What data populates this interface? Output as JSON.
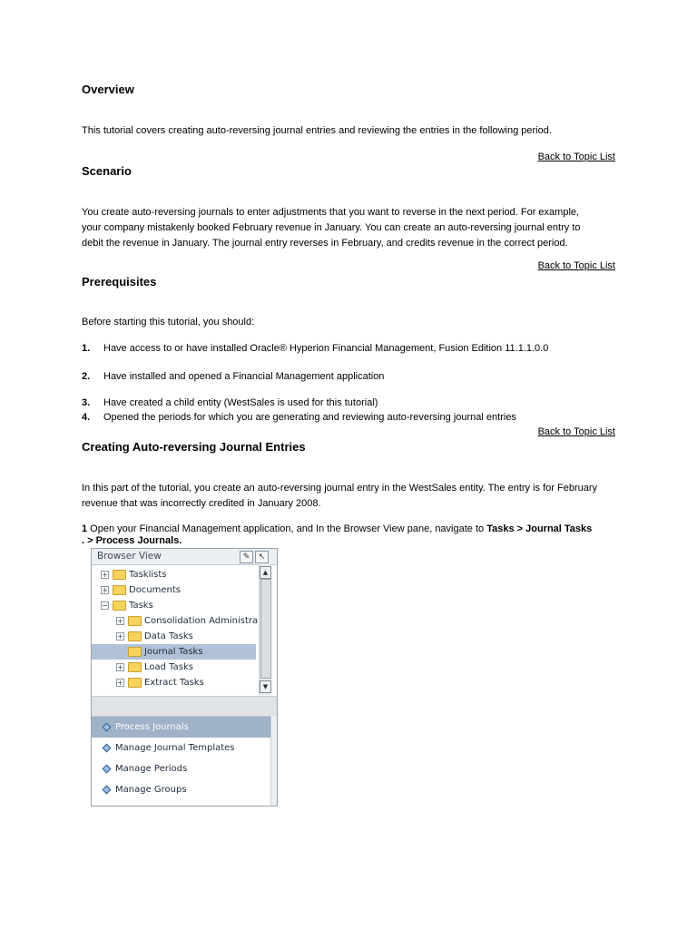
{
  "overview": {
    "heading": "Overview",
    "text": "This tutorial covers creating auto-reversing journal entries and reviewing the entries in the following period."
  },
  "back_link": "Back to Topic List",
  "scenario": {
    "heading": "Scenario",
    "lines": [
      "You create auto-reversing journals to enter adjustments that you want to reverse in the next period. For example,",
      "your company mistakenly booked February revenue in January. You can create an auto-reversing journal entry to",
      "debit the revenue in January. The journal entry reverses in February, and credits revenue in the correct period."
    ]
  },
  "prerequisites": {
    "heading": "Prerequisites",
    "intro": "Before starting this tutorial, you should:",
    "items": [
      {
        "num": "1.",
        "text": "Have access to or have installed Oracle® Hyperion Financial Management, Fusion Edition 11.1.1.0.0"
      },
      {
        "num": "2.",
        "text": "Have installed and opened a Financial Management application"
      },
      {
        "num": "3.",
        "text": "Have created a child entity (WestSales is used for this tutorial)"
      },
      {
        "num": "4.",
        "text": "Opened the periods for which you are generating and reviewing auto-reversing journal entries"
      }
    ]
  },
  "creating": {
    "heading": "Creating Auto-reversing Journal Entries",
    "lines": [
      "In this part of the tutorial, you create an auto-reversing journal entry in the WestSales entity. The entry is for February",
      "revenue that was incorrectly credited in January 2008."
    ],
    "step_num": "1",
    "step_text": " Open your Financial Management application, and In the Browser View pane, navigate to ",
    "step_bold1": "Tasks > Journal Tasks",
    "step_dot": ". > ",
    "step_bold2": "Process Journals."
  },
  "browser": {
    "title": "Browser View",
    "tree": [
      {
        "label": "Tasklists",
        "exp": "+"
      },
      {
        "label": "Documents",
        "exp": "+"
      },
      {
        "label": "Tasks",
        "exp": "−"
      },
      {
        "label": "Consolidation Administra...",
        "exp": "+"
      },
      {
        "label": "Data Tasks",
        "exp": "+"
      },
      {
        "label": "Journal Tasks",
        "exp": ""
      },
      {
        "label": "Load Tasks",
        "exp": "+"
      },
      {
        "label": "Extract Tasks",
        "exp": "+"
      }
    ],
    "tasks": [
      "Process Journals",
      "Manage Journal Templates",
      "Manage Periods",
      "Manage Groups"
    ]
  }
}
